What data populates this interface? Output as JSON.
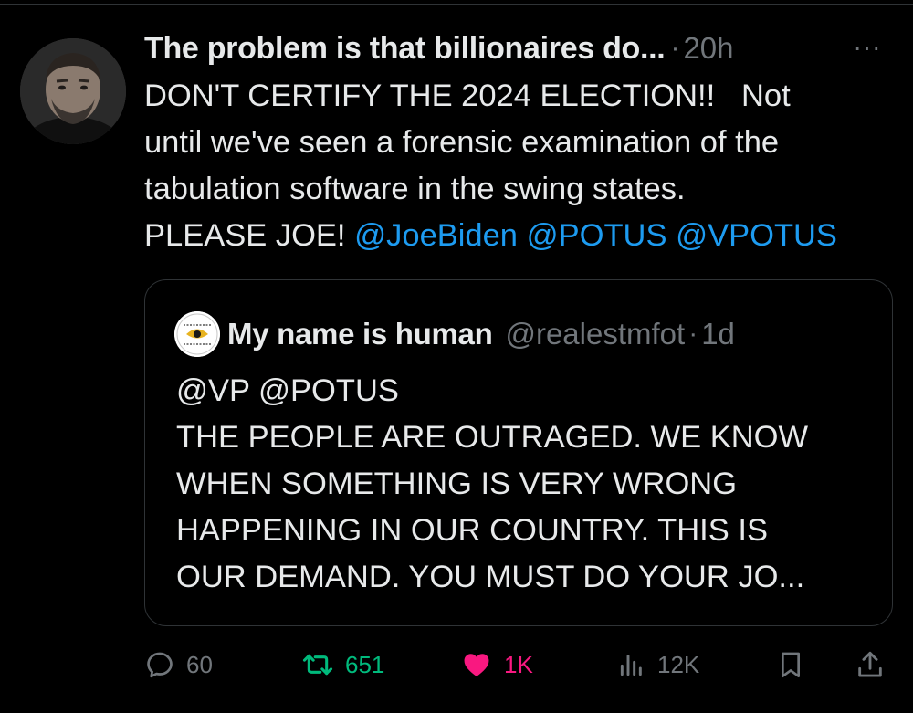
{
  "post": {
    "author_name": "The problem is that billionaires do...",
    "separator": "·",
    "timestamp": "20h",
    "more_label": "···",
    "text_lines": [
      "DON'T CERTIFY THE 2024 ELECTION!!   Not",
      "until we've seen a forensic examination of the",
      "tabulation software in the swing states."
    ],
    "last_line_prefix": "PLEASE JOE! ",
    "mentions": [
      "@JoeBiden",
      "@POTUS",
      "@VPOTUS"
    ]
  },
  "quote": {
    "author_name": "My name is human",
    "handle": "@realestmfot",
    "separator": "·",
    "timestamp": "1d",
    "text_lines": [
      "@VP @POTUS",
      "THE PEOPLE ARE OUTRAGED. WE KNOW",
      "WHEN SOMETHING IS VERY WRONG",
      "HAPPENING IN OUR COUNTRY. THIS IS",
      "OUR DEMAND. YOU MUST DO YOUR JO..."
    ]
  },
  "actions": {
    "replies": "60",
    "reposts": "651",
    "likes": "1K",
    "views": "12K",
    "bookmark_icon": "bookmark-icon",
    "share_icon": "share-icon"
  },
  "colors": {
    "background": "#000000",
    "text": "#e7e9ea",
    "secondary": "#71767b",
    "mention": "#1d9bf0",
    "repost": "#00ba7c",
    "like": "#f91880",
    "border": "#2f3336"
  }
}
